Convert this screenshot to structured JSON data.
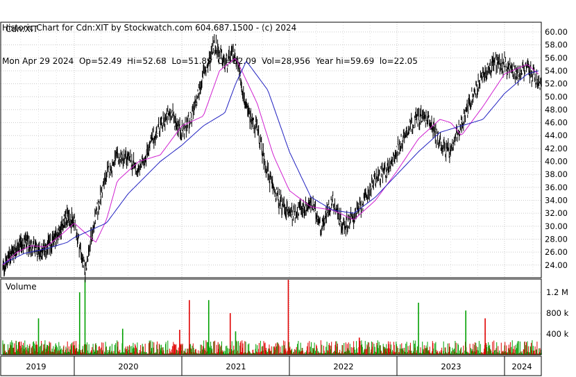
{
  "header": {
    "line1": "Historic Chart for Cdn:XIT by Stockwatch.com 604.687.1500 - (c) 2024",
    "line2": "Mon Apr 29 2024  Op=52.49  Hi=52.68  Lo=51.89  Cl=52.09  Vol=28,956  Year hi=59.69  lo=22.05"
  },
  "chart_data": [
    {
      "type": "line",
      "title": "Cdn:XIT",
      "price_scale": "right",
      "ylim": [
        22.05,
        61.5
      ],
      "yticks": [
        "60.00",
        "58.00",
        "56.00",
        "54.00",
        "52.00",
        "50.00",
        "48.00",
        "46.00",
        "44.00",
        "42.00",
        "40.00",
        "38.00",
        "36.00",
        "34.00",
        "32.00",
        "30.00",
        "28.00",
        "26.00",
        "24.00"
      ],
      "x_years": [
        "2019",
        "2020",
        "2021",
        "2022",
        "2023",
        "2024"
      ],
      "grid": true,
      "series": [
        {
          "name": "",
          "kind": "price-bars",
          "color": "#000000",
          "x": [
            2019.0,
            2019.1,
            2019.2,
            2019.3,
            2019.4,
            2019.5,
            2019.6,
            2019.7,
            2019.8,
            2019.9,
            2020.0,
            2020.05,
            2020.1,
            2020.15,
            2020.2,
            2020.25,
            2020.3,
            2020.4,
            2020.5,
            2020.6,
            2020.7,
            2020.8,
            2020.9,
            2021.0,
            2021.1,
            2021.2,
            2021.25,
            2021.3,
            2021.4,
            2021.5,
            2021.6,
            2021.7,
            2021.8,
            2021.9,
            2022.0,
            2022.1,
            2022.2,
            2022.3,
            2022.4,
            2022.5,
            2022.6,
            2022.7,
            2022.8,
            2022.9,
            2023.0,
            2023.1,
            2023.2,
            2023.3,
            2023.4,
            2023.5,
            2023.6,
            2023.7,
            2023.8,
            2023.9,
            2024.0,
            2024.1,
            2024.2,
            2024.3
          ],
          "y": [
            23.5,
            25.5,
            26.8,
            27.5,
            27.0,
            26.0,
            26.5,
            27.5,
            29.5,
            31.5,
            30.5,
            27.0,
            23.0,
            27.5,
            31.5,
            35.0,
            38.0,
            40.5,
            40.5,
            38.5,
            42.5,
            45.5,
            47.5,
            44.5,
            47.0,
            53.5,
            55.0,
            58.5,
            55.0,
            57.0,
            48.0,
            45.0,
            38.0,
            34.0,
            32.0,
            32.5,
            33.5,
            30.0,
            34.0,
            30.0,
            31.5,
            34.0,
            37.5,
            38.5,
            41.5,
            45.0,
            47.0,
            46.5,
            43.0,
            41.0,
            46.0,
            50.0,
            53.0,
            55.5,
            55.0,
            53.5,
            54.5,
            52.0
          ]
        },
        {
          "name": "",
          "kind": "short-ma",
          "color": "#d020d0",
          "x": [
            2019.0,
            2019.2,
            2019.4,
            2019.6,
            2019.8,
            2020.0,
            2020.1,
            2020.2,
            2020.3,
            2020.4,
            2020.6,
            2020.8,
            2021.0,
            2021.2,
            2021.35,
            2021.5,
            2021.7,
            2021.85,
            2022.0,
            2022.2,
            2022.4,
            2022.6,
            2022.8,
            2023.0,
            2023.2,
            2023.4,
            2023.5,
            2023.6,
            2023.8,
            2024.0,
            2024.2,
            2024.3
          ],
          "y": [
            24.0,
            26.0,
            27.0,
            26.8,
            28.5,
            30.5,
            29.0,
            27.5,
            31.0,
            37.0,
            40.0,
            41.0,
            45.5,
            47.0,
            54.0,
            56.0,
            49.0,
            41.0,
            35.5,
            33.0,
            32.5,
            31.0,
            34.0,
            38.5,
            43.5,
            46.5,
            46.0,
            44.0,
            48.5,
            53.5,
            55.0,
            53.5
          ]
        },
        {
          "name": "",
          "kind": "long-ma",
          "color": "#2020c0",
          "x": [
            2019.0,
            2019.3,
            2019.6,
            2019.9,
            2020.1,
            2020.3,
            2020.5,
            2020.8,
            2021.0,
            2021.2,
            2021.4,
            2021.5,
            2021.6,
            2021.8,
            2022.0,
            2022.2,
            2022.4,
            2022.6,
            2022.8,
            2023.0,
            2023.2,
            2023.4,
            2023.6,
            2023.8,
            2024.0,
            2024.2,
            2024.3
          ],
          "y": [
            24.2,
            25.8,
            26.5,
            27.5,
            29.0,
            30.5,
            35.0,
            40.0,
            42.5,
            45.5,
            47.5,
            52.0,
            55.5,
            51.0,
            41.5,
            34.5,
            32.5,
            32.0,
            34.5,
            38.0,
            41.5,
            44.5,
            45.5,
            46.5,
            50.5,
            53.5,
            54.0
          ]
        }
      ]
    },
    {
      "type": "bar",
      "title": "Volume",
      "ylim": [
        0,
        1400000
      ],
      "yticks": [
        "1.2 M",
        "800 k",
        "400 k"
      ],
      "ytick_values": [
        1200000,
        800000,
        400000
      ],
      "bar_colors": {
        "up": "#00a000",
        "down": "#e00000"
      },
      "spikes": [
        {
          "x": 2019.5,
          "v": 700000,
          "dir": "up"
        },
        {
          "x": 2020.05,
          "v": 1200000,
          "dir": "up"
        },
        {
          "x": 2020.1,
          "v": 1450000,
          "dir": "up"
        },
        {
          "x": 2020.45,
          "v": 500000,
          "dir": "up"
        },
        {
          "x": 2020.98,
          "v": 480000,
          "dir": "down"
        },
        {
          "x": 2021.07,
          "v": 1050000,
          "dir": "down"
        },
        {
          "x": 2021.25,
          "v": 1050000,
          "dir": "up"
        },
        {
          "x": 2021.45,
          "v": 800000,
          "dir": "down"
        },
        {
          "x": 2021.5,
          "v": 450000,
          "dir": "up"
        },
        {
          "x": 2021.99,
          "v": 1450000,
          "dir": "down"
        },
        {
          "x": 2022.65,
          "v": 330000,
          "dir": "down"
        },
        {
          "x": 2023.2,
          "v": 1000000,
          "dir": "up"
        },
        {
          "x": 2023.64,
          "v": 850000,
          "dir": "up"
        },
        {
          "x": 2023.82,
          "v": 700000,
          "dir": "down"
        }
      ]
    }
  ]
}
